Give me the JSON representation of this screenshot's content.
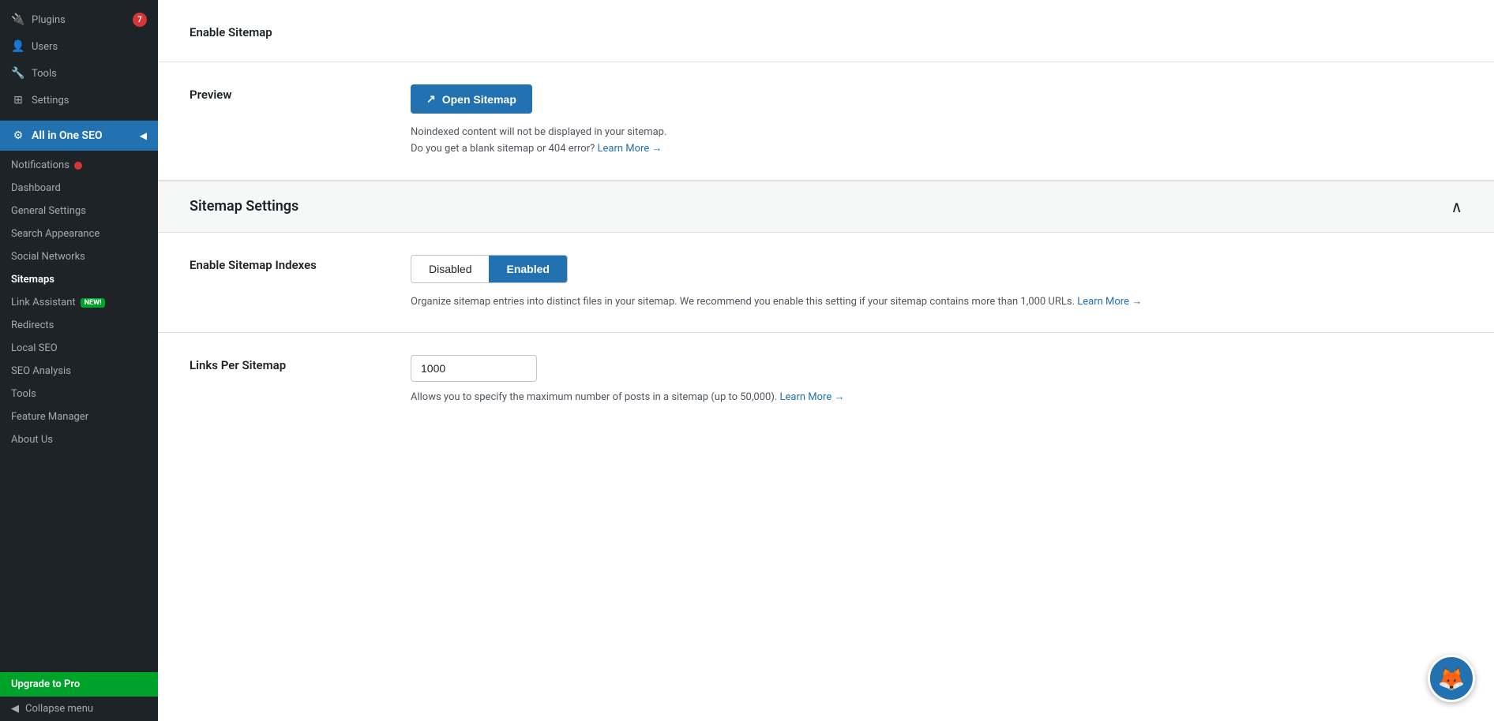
{
  "sidebar": {
    "top_items": [
      {
        "id": "plugins",
        "label": "Plugins",
        "badge": "7",
        "icon": "🔌"
      },
      {
        "id": "users",
        "label": "Users",
        "icon": "👤"
      },
      {
        "id": "tools",
        "label": "Tools",
        "icon": "🔧"
      },
      {
        "id": "settings",
        "label": "Settings",
        "icon": "⊞"
      }
    ],
    "aioseo": {
      "label": "All in One SEO",
      "active": true
    },
    "sub_items": [
      {
        "id": "notifications",
        "label": "Notifications",
        "has_dot": true
      },
      {
        "id": "dashboard",
        "label": "Dashboard",
        "has_dot": false
      },
      {
        "id": "general-settings",
        "label": "General Settings",
        "has_dot": false
      },
      {
        "id": "search-appearance",
        "label": "Search Appearance",
        "has_dot": false
      },
      {
        "id": "social-networks",
        "label": "Social Networks",
        "has_dot": false
      },
      {
        "id": "sitemaps",
        "label": "Sitemaps",
        "has_dot": false,
        "active": true
      },
      {
        "id": "link-assistant",
        "label": "Link Assistant",
        "is_new": true,
        "has_dot": false
      },
      {
        "id": "redirects",
        "label": "Redirects",
        "has_dot": false
      },
      {
        "id": "local-seo",
        "label": "Local SEO",
        "has_dot": false
      },
      {
        "id": "seo-analysis",
        "label": "SEO Analysis",
        "has_dot": false
      },
      {
        "id": "tools",
        "label": "Tools",
        "has_dot": false
      },
      {
        "id": "feature-manager",
        "label": "Feature Manager",
        "has_dot": false
      },
      {
        "id": "about-us",
        "label": "About Us",
        "has_dot": false
      }
    ],
    "upgrade_label": "Upgrade to Pro",
    "collapse_label": "Collapse menu"
  },
  "main": {
    "enable_sitemap": {
      "label": "Enable Sitemap",
      "enabled": true
    },
    "preview": {
      "label": "Preview",
      "button_label": "Open Sitemap",
      "note_line1": "Noindexed content will not be displayed in your sitemap.",
      "note_line2": "Do you get a blank sitemap or 404 error?",
      "learn_more_label": "Learn More →"
    },
    "sitemap_settings": {
      "section_title": "Sitemap Settings",
      "enable_indexes": {
        "label": "Enable Sitemap Indexes",
        "disabled_label": "Disabled",
        "enabled_label": "Enabled",
        "active": "enabled",
        "description": "Organize sitemap entries into distinct files in your sitemap. We recommend you enable this setting if your sitemap contains more than 1,000 URLs.",
        "learn_more_label": "Learn More →"
      },
      "links_per_sitemap": {
        "label": "Links Per Sitemap",
        "value": "1000",
        "description": "Allows you to specify the maximum number of posts in a sitemap (up to 50,000).",
        "learn_more_label": "Learn More →"
      }
    }
  },
  "avatar": {
    "emoji": "🦊"
  }
}
